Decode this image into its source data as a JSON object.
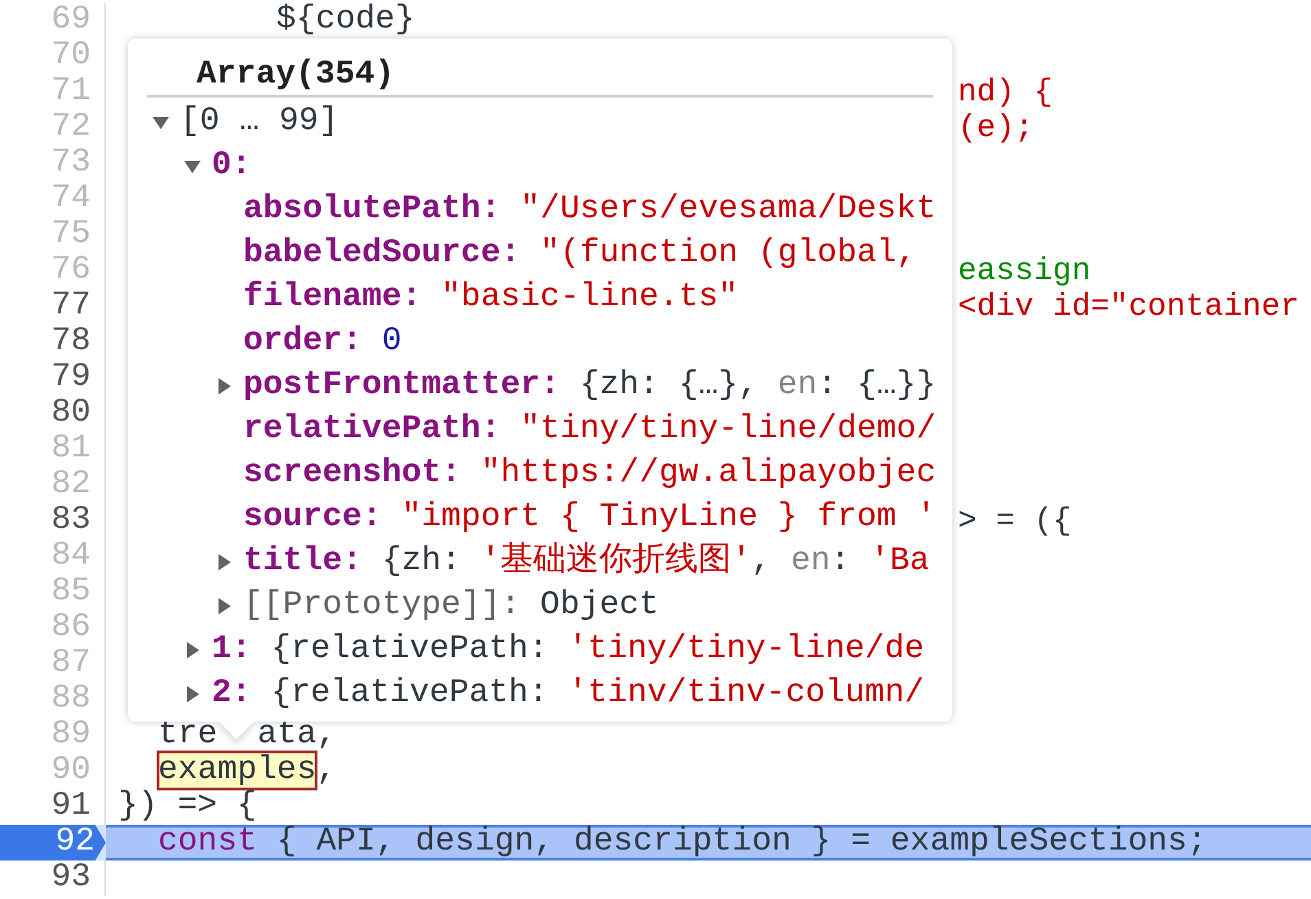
{
  "editor": {
    "lines": [
      {
        "number": "69",
        "muted": true,
        "kind": "deep",
        "segments": [
          {
            "text": "${code}",
            "kind": "plain"
          }
        ]
      },
      {
        "number": "70",
        "muted": true
      },
      {
        "number": "71",
        "muted": true,
        "segments": [
          {
            "text": "nd) {",
            "kind": "string",
            "tail": true
          }
        ]
      },
      {
        "number": "72",
        "muted": true,
        "segments": [
          {
            "text": "(e);",
            "kind": "string",
            "tail": true
          }
        ]
      },
      {
        "number": "73",
        "muted": true
      },
      {
        "number": "74",
        "muted": true
      },
      {
        "number": "75",
        "muted": true
      },
      {
        "number": "76",
        "muted": true,
        "segments": [
          {
            "text": "eassign",
            "kind": "comment",
            "tail": true
          }
        ]
      },
      {
        "number": "77",
        "muted": false,
        "segments": [
          {
            "text": "<div id=\"container",
            "kind": "string",
            "tail": true
          }
        ]
      },
      {
        "number": "78",
        "muted": false
      },
      {
        "number": "79",
        "muted": false
      },
      {
        "number": "80",
        "muted": false
      },
      {
        "number": "81",
        "muted": true
      },
      {
        "number": "82",
        "muted": true
      },
      {
        "number": "83",
        "muted": false,
        "segments": [
          {
            "text": "> = ({",
            "kind": "plain",
            "tail": true
          }
        ]
      },
      {
        "number": "84",
        "muted": true
      },
      {
        "number": "85",
        "muted": true
      },
      {
        "number": "86",
        "muted": true
      },
      {
        "number": "87",
        "muted": true
      },
      {
        "number": "88",
        "muted": true
      },
      {
        "number": "89",
        "muted": true,
        "kind": "nested",
        "segments": [
          {
            "text": "tre",
            "kind": "plain"
          },
          {
            "text": "ata,",
            "kind": "plain",
            "gap": true
          }
        ]
      },
      {
        "number": "90",
        "muted": true,
        "kind": "nested",
        "segments": [
          {
            "text": "examples",
            "kind": "match"
          },
          {
            "text": ",",
            "kind": "plain"
          }
        ]
      },
      {
        "number": "91",
        "muted": false,
        "segments": [
          {
            "text": "}) => {",
            "kind": "plain"
          }
        ]
      },
      {
        "number": "92",
        "muted": false,
        "current": true,
        "kind": "nested",
        "segments": [
          {
            "text": "const",
            "kind": "keyword"
          },
          {
            "text": " { API, design, description } = exampleSections;",
            "kind": "plain"
          }
        ]
      },
      {
        "number": "93",
        "muted": false
      }
    ]
  },
  "popover": {
    "title": "Array(354)",
    "tree": [
      {
        "key": "[0 … 99]",
        "kind": "range",
        "expanded": true,
        "children": [
          {
            "key": "0:",
            "kind": "index",
            "expanded": true,
            "children": [
              {
                "key": "absolutePath:",
                "kind": "prop",
                "value": [
                  {
                    "text": "\"/Users/evesama/Deskt",
                    "kind": "string"
                  }
                ]
              },
              {
                "key": "babeledSource:",
                "kind": "prop",
                "value": [
                  {
                    "text": "\"(function (global,",
                    "kind": "string"
                  }
                ]
              },
              {
                "key": "filename:",
                "kind": "prop",
                "value": [
                  {
                    "text": "\"basic-line.ts\"",
                    "kind": "string"
                  }
                ]
              },
              {
                "key": "order:",
                "kind": "prop",
                "value": [
                  {
                    "text": "0",
                    "kind": "number"
                  }
                ]
              },
              {
                "key": "postFrontmatter:",
                "kind": "prop",
                "expanded": false,
                "value": [
                  {
                    "text": "{zh: {…},",
                    "kind": "plain"
                  },
                  {
                    "text": " en",
                    "kind": "dim"
                  },
                  {
                    "text": ": {…}}",
                    "kind": "plain"
                  }
                ]
              },
              {
                "key": "relativePath:",
                "kind": "prop",
                "value": [
                  {
                    "text": "\"tiny/tiny-line/demo/",
                    "kind": "string"
                  }
                ]
              },
              {
                "key": "screenshot:",
                "kind": "prop",
                "value": [
                  {
                    "text": "\"https://gw.alipayobjec",
                    "kind": "string"
                  }
                ]
              },
              {
                "key": "source:",
                "kind": "prop",
                "value": [
                  {
                    "text": "\"import { TinyLine } from '",
                    "kind": "string"
                  }
                ]
              },
              {
                "key": "title:",
                "kind": "prop",
                "expanded": false,
                "value": [
                  {
                    "text": "{zh: ",
                    "kind": "plain"
                  },
                  {
                    "text": "'基础迷你折线图'",
                    "kind": "string"
                  },
                  {
                    "text": ",",
                    "kind": "plain"
                  },
                  {
                    "text": " en",
                    "kind": "dim"
                  },
                  {
                    "text": ": ",
                    "kind": "plain"
                  },
                  {
                    "text": "'Ba",
                    "kind": "string"
                  }
                ]
              },
              {
                "key": "[[Prototype]]:",
                "kind": "internal",
                "expanded": false,
                "value": [
                  {
                    "text": "Object",
                    "kind": "plain"
                  }
                ]
              }
            ]
          },
          {
            "key": "1:",
            "kind": "index",
            "expanded": false,
            "value": [
              {
                "text": "{relativePath: ",
                "kind": "plain"
              },
              {
                "text": "'tiny/tiny-line/de",
                "kind": "string"
              }
            ]
          },
          {
            "key": "2:",
            "kind": "index",
            "expanded": false,
            "value": [
              {
                "text": "{relativePath: ",
                "kind": "plain"
              },
              {
                "text": "'tinv/tinv-column/",
                "kind": "string"
              }
            ]
          }
        ]
      }
    ]
  }
}
